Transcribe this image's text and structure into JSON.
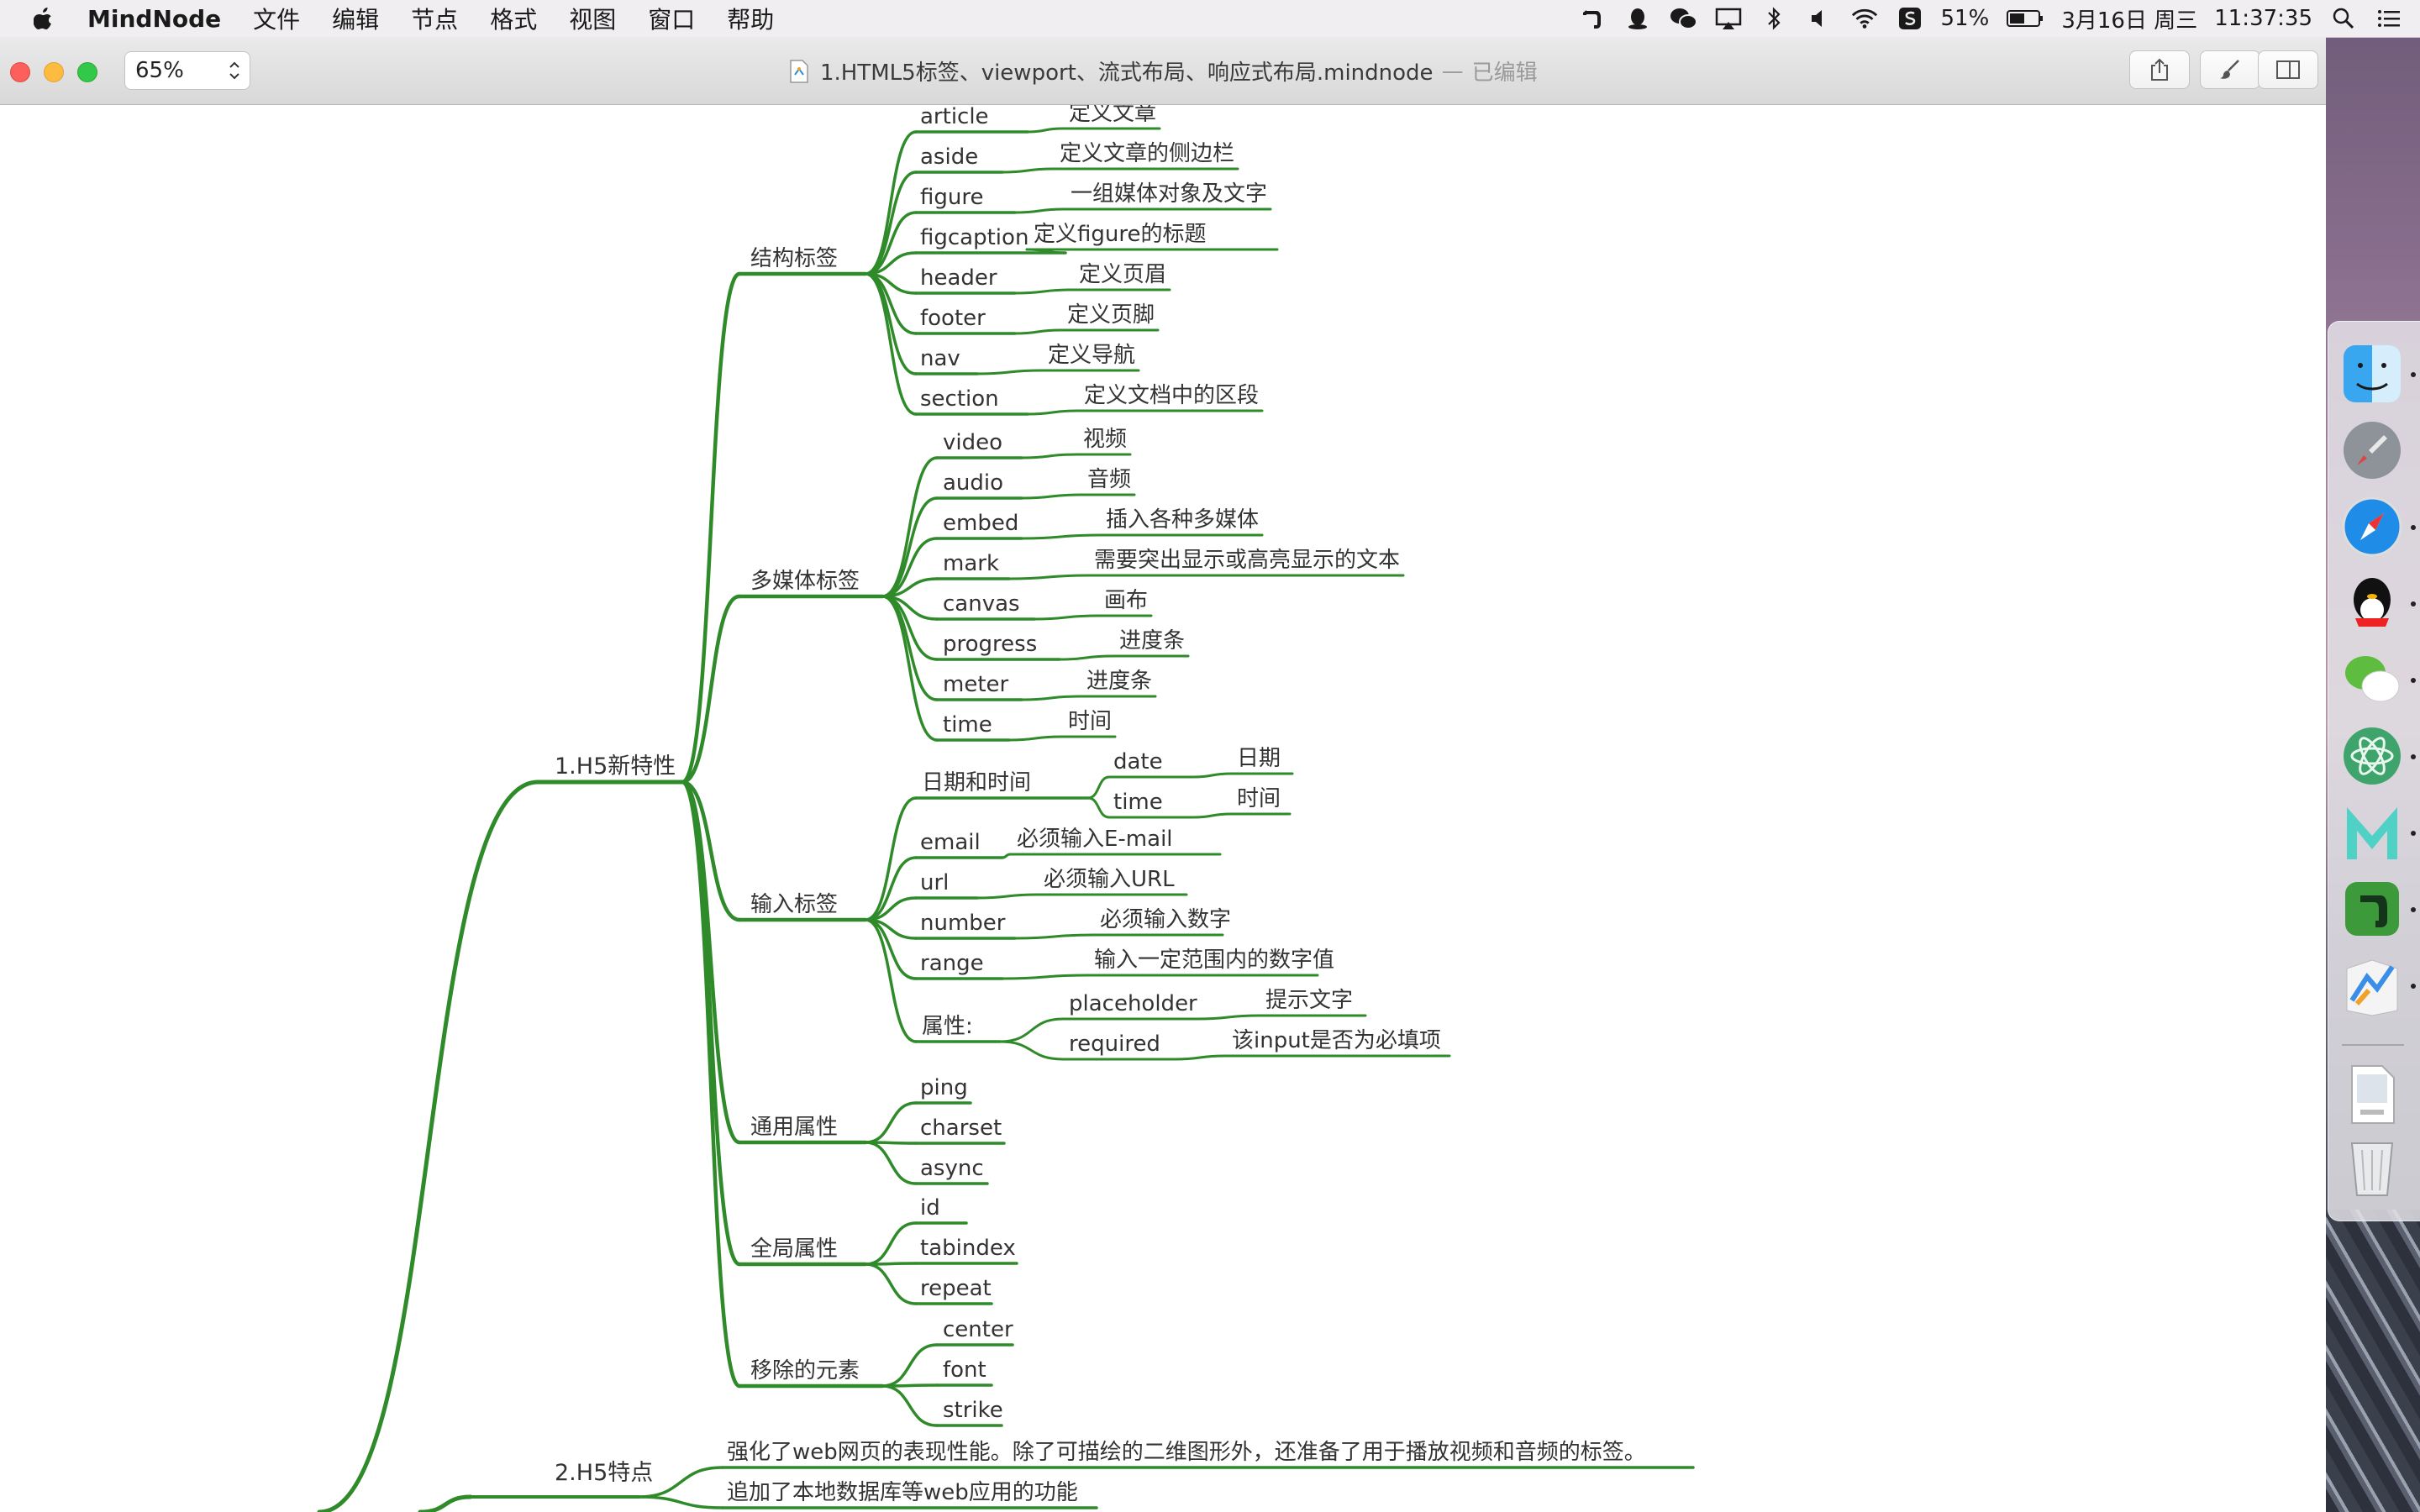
{
  "menubar": {
    "app_name": "MindNode",
    "menus": [
      "文件",
      "编辑",
      "节点",
      "格式",
      "视图",
      "窗口",
      "帮助"
    ],
    "battery": "51%",
    "date": "3月16日 周三",
    "time": "11:37:35"
  },
  "window": {
    "zoom": "65%",
    "doc_title": "1.HTML5标签、viewport、流式布局、响应式布局.mindnode",
    "separator": "—",
    "edited_label": "已编辑"
  },
  "mindmap": {
    "main1": "1.H5新特性",
    "main2": "2.H5特点",
    "groups": {
      "struct": {
        "label": "结构标签",
        "items": [
          [
            "article",
            "定义文章"
          ],
          [
            "aside",
            "定义文章的侧边栏"
          ],
          [
            "figure",
            "一组媒体对象及文字"
          ],
          [
            "figcaption",
            "定义figure的标题"
          ],
          [
            "header",
            "定义页眉"
          ],
          [
            "footer",
            "定义页脚"
          ],
          [
            "nav",
            "定义导航"
          ],
          [
            "section",
            "定义文档中的区段"
          ]
        ]
      },
      "media": {
        "label": "多媒体标签",
        "items": [
          [
            "video",
            "视频"
          ],
          [
            "audio",
            "音频"
          ],
          [
            "embed",
            "插入各种多媒体"
          ],
          [
            "mark",
            "需要突出显示或高亮显示的文本"
          ],
          [
            "canvas",
            "画布"
          ],
          [
            "progress",
            "进度条"
          ],
          [
            "meter",
            "进度条"
          ],
          [
            "time",
            "时间"
          ]
        ]
      },
      "input": {
        "label": "输入标签",
        "datetime": "日期和时间",
        "datetime_items": [
          [
            "date",
            "日期"
          ],
          [
            "time",
            "时间"
          ]
        ],
        "items": [
          [
            "email",
            "必须输入E-mail"
          ],
          [
            "url",
            "必须输入URL"
          ],
          [
            "number",
            "必须输入数字"
          ],
          [
            "range",
            "输入一定范围内的数字值"
          ]
        ],
        "attr": "属性:",
        "attr_items": [
          [
            "placeholder",
            "提示文字"
          ],
          [
            "required",
            "该input是否为必填项"
          ]
        ]
      },
      "common": {
        "label": "通用属性",
        "items": [
          "ping",
          "charset",
          "async"
        ]
      },
      "global": {
        "label": "全局属性",
        "items": [
          "id",
          "tabindex",
          "repeat"
        ]
      },
      "removed": {
        "label": "移除的元素",
        "items": [
          "center",
          "font",
          "strike"
        ]
      }
    },
    "features": [
      "强化了web网页的表现性能。除了可描绘的二维图形外，还准备了用于播放视频和音频的标签。",
      "追加了本地数据库等web应用的功能"
    ]
  },
  "colors": {
    "branch": "#2f8a2a",
    "close": "#fc605c",
    "minimize": "#fdbc40",
    "maximize": "#34c84a"
  },
  "dock": {
    "apps": [
      "finder-icon",
      "launchpad-icon",
      "safari-icon",
      "qq-icon",
      "wechat-icon",
      "atom-icon",
      "mindnode-m-icon",
      "evernote-icon",
      "mindnode-icon"
    ],
    "files": [
      "html-document-icon",
      "trash-icon"
    ]
  }
}
